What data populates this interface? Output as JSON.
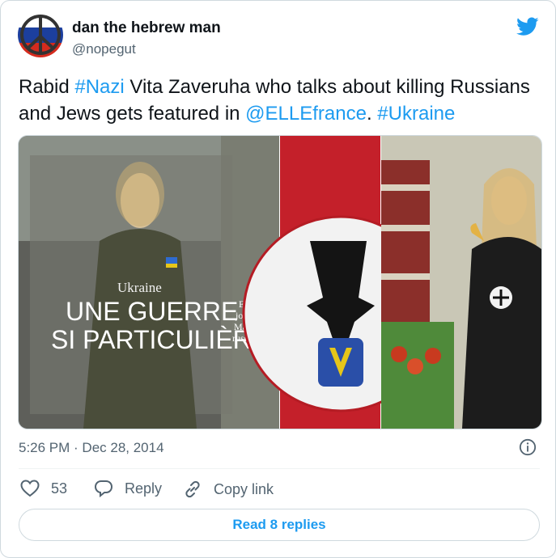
{
  "author": {
    "display_name": "dan the hebrew man",
    "handle": "@nopegut"
  },
  "tweet": {
    "text_segments": [
      {
        "text": "Rabid ",
        "link": false
      },
      {
        "text": "#Nazi",
        "link": true
      },
      {
        "text": " Vita Zaveruha who talks about killing Russians and Jews gets featured in ",
        "link": false
      },
      {
        "text": "@ELLEfrance",
        "link": true
      },
      {
        "text": ". ",
        "link": false
      },
      {
        "text": "#Ukraine",
        "link": true
      }
    ]
  },
  "media": {
    "magazine_section": "Ukraine",
    "headline_line1": "UNE GUERRE",
    "headline_line2": "SI PARTICULIÈRE",
    "side_text": [
      "Elles étai",
      "journaliste",
      "Maïdan à la",
      "russes, les Uk",
      "tous"
    ]
  },
  "meta": {
    "timestamp": "5:26 PM · Dec 28, 2014"
  },
  "actions": {
    "likes_count": "53",
    "reply_label": "Reply",
    "copy_link_label": "Copy link"
  },
  "footer": {
    "read_replies_label": "Read 8 replies"
  },
  "colors": {
    "accent": "#1d9bf0",
    "secondary_text": "#536471",
    "border": "#cfd9de"
  }
}
